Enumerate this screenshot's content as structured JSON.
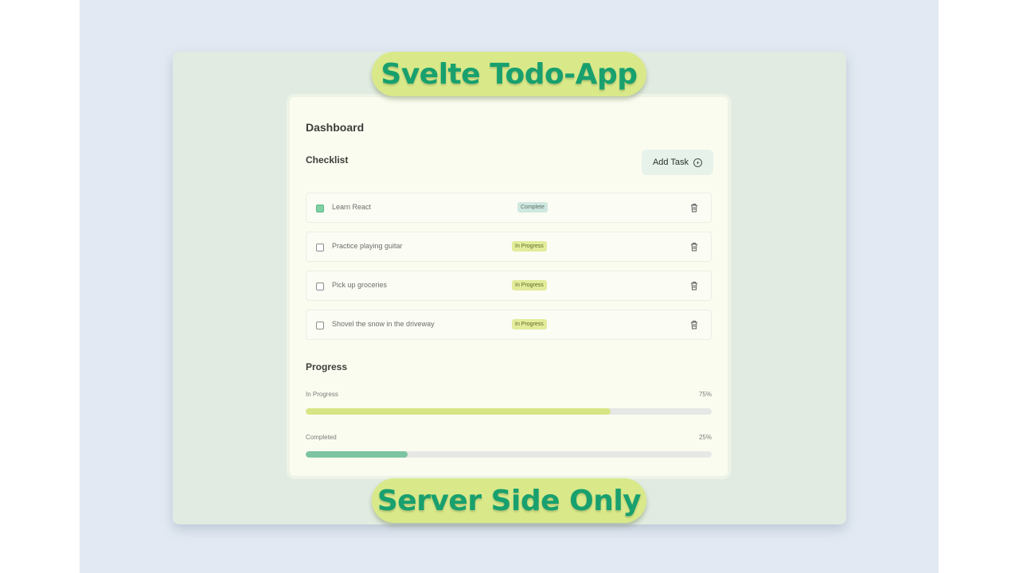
{
  "banner": {
    "top": "Svelte Todo-App",
    "bottom": "Server Side Only"
  },
  "dashboard": {
    "title": "Dashboard",
    "checklist_title": "Checklist",
    "add_task_label": "Add Task",
    "tasks": [
      {
        "label": "Learn React",
        "status": "Complete",
        "checked": true
      },
      {
        "label": "Practice playing guitar",
        "status": "In Progress",
        "checked": false
      },
      {
        "label": "Pick up groceries",
        "status": "In Progress",
        "checked": false
      },
      {
        "label": "Shovel the snow in the driveway",
        "status": "In Progress",
        "checked": false
      }
    ],
    "progress": {
      "title": "Progress",
      "rows": [
        {
          "label": "In Progress",
          "percent_text": "75%",
          "fraction": 0.75,
          "color": "#d8e585"
        },
        {
          "label": "Completed",
          "percent_text": "25%",
          "fraction": 0.25,
          "color": "#7cc4a2"
        }
      ]
    }
  },
  "icons": {
    "add": "plus-circle-icon",
    "delete": "trash-icon",
    "checkbox": "checkbox-icon"
  },
  "colors": {
    "accent_text": "#18a06e",
    "pill_bg": "#d9e98a",
    "board_bg": "#e1ebe1"
  }
}
